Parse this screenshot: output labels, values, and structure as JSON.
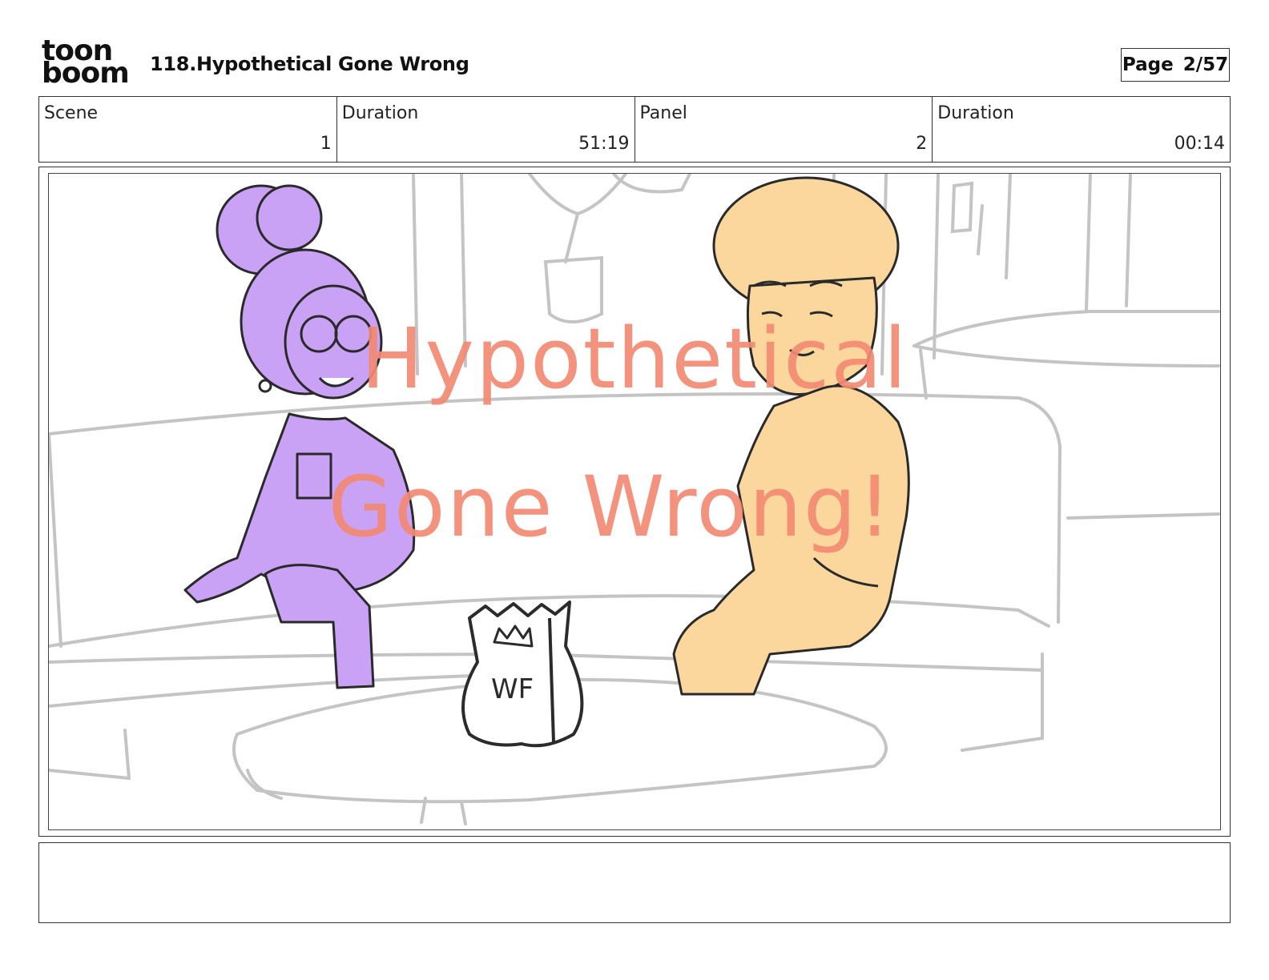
{
  "logo": {
    "line1": "toon",
    "line2": "boom"
  },
  "header": {
    "title": "118.Hypothetical Gone Wrong",
    "page_label": "Page",
    "page_value": "2/57"
  },
  "info": [
    {
      "label": "Scene",
      "value": "1"
    },
    {
      "label": "Duration",
      "value": "51:19"
    },
    {
      "label": "Panel",
      "value": "2"
    },
    {
      "label": "Duration",
      "value": "00:14"
    }
  ],
  "panel": {
    "watermark_line1": "Hypothetical",
    "watermark_line2": "Gone Wrong!",
    "bag_letters": "WF"
  },
  "notes": {
    "text": ""
  },
  "colors": {
    "woman": "#c9a2f5",
    "man": "#fbd79e",
    "watermark": "#f38a73",
    "sketch": "#c4c4c4"
  }
}
